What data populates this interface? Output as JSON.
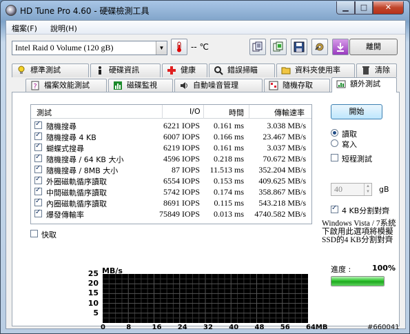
{
  "window": {
    "title": "HD Tune Pro 4.60 - 硬碟檢測工具",
    "min_symbol": "▁",
    "max_symbol": "□",
    "close_symbol": "✕"
  },
  "menu": {
    "items": [
      "檔案(F)",
      "說明(H)"
    ]
  },
  "toolbar": {
    "drive": "Intel  Raid 0 Volume (120 gB)",
    "temperature_text": "-- ℃",
    "exit_label": "離開",
    "icons": [
      "copy-info-icon",
      "copy-screenshot-icon",
      "save-icon",
      "settings-icon",
      "download-icon"
    ]
  },
  "tabs_row1": [
    {
      "label": "標準測試",
      "icon": "bulb-icon"
    },
    {
      "label": "硬碟資訊",
      "icon": "info-icon"
    },
    {
      "label": "健康",
      "icon": "health-cross-icon"
    },
    {
      "label": "錯誤掃瞄",
      "icon": "scan-icon"
    },
    {
      "label": "資料夾使用率",
      "icon": "folder-icon"
    },
    {
      "label": "清除",
      "icon": "trash-icon"
    }
  ],
  "tabs_row2": [
    {
      "label": "檔案效能測試",
      "icon": "file-bench-icon"
    },
    {
      "label": "磁碟監視",
      "icon": "monitor-icon"
    },
    {
      "label": "自動噪音管理",
      "icon": "speaker-icon"
    },
    {
      "label": "隨機存取",
      "icon": "random-access-icon"
    },
    {
      "label": "額外測試",
      "icon": "extra-tests-icon",
      "active": true
    }
  ],
  "results": {
    "headers": {
      "test": "測試",
      "io": "I/O",
      "time": "時間",
      "rate": "傳輸速率"
    },
    "rows": [
      {
        "name": "隨機搜尋",
        "io": "6221 IOPS",
        "time": "0.161 ms",
        "rate": "3.038 MB/s"
      },
      {
        "name": "隨機搜尋 4 KB",
        "io": "6007 IOPS",
        "time": "0.166 ms",
        "rate": "23.467 MB/s"
      },
      {
        "name": "蝴蝶式搜尋",
        "io": "6219 IOPS",
        "time": "0.161 ms",
        "rate": "3.037 MB/s"
      },
      {
        "name": "隨機搜尋 / 64 KB 大小",
        "io": "4596 IOPS",
        "time": "0.218 ms",
        "rate": "70.672 MB/s"
      },
      {
        "name": "隨機搜尋 / 8MB 大小",
        "io": "87 IOPS",
        "time": "11.513 ms",
        "rate": "352.204 MB/s"
      },
      {
        "name": "外圈磁軌循序讀取",
        "io": "6554 IOPS",
        "time": "0.153 ms",
        "rate": "409.625 MB/s"
      },
      {
        "name": "中間磁軌循序讀取",
        "io": "5742 IOPS",
        "time": "0.174 ms",
        "rate": "358.867 MB/s"
      },
      {
        "name": "內圈磁軌循序讀取",
        "io": "8691 IOPS",
        "time": "0.115 ms",
        "rate": "543.218 MB/s"
      },
      {
        "name": "爆發傳輸率",
        "io": "75849 IOPS",
        "time": "0.013 ms",
        "rate": "4740.582 MB/s"
      }
    ]
  },
  "quick_scan_label": "快取",
  "controls": {
    "start_label": "開始",
    "read_label": "讀取",
    "write_label": "寫入",
    "short_test_label": "短程測試",
    "size_value": "40",
    "size_unit": "gB",
    "align_label": "4 KB分割對齊",
    "align_note": "Windows Vista / 7系統下啟用此選項將模擬SSD的4 KB分割對齊",
    "progress_label": "進度 :",
    "progress_value": "100%",
    "progress_fraction": 1.0
  },
  "chart_data": {
    "type": "line",
    "title": "",
    "ylabel": "MB/s",
    "xlabel": "",
    "yticks": [
      "25",
      "20",
      "15",
      "10",
      "5"
    ],
    "xticks": [
      "0",
      "8",
      "16",
      "24",
      "32",
      "40",
      "48",
      "56",
      "64MB"
    ],
    "ylim": [
      0,
      25
    ],
    "xlim": [
      0,
      64
    ],
    "grid": true,
    "series": []
  },
  "watermark": "#660041"
}
